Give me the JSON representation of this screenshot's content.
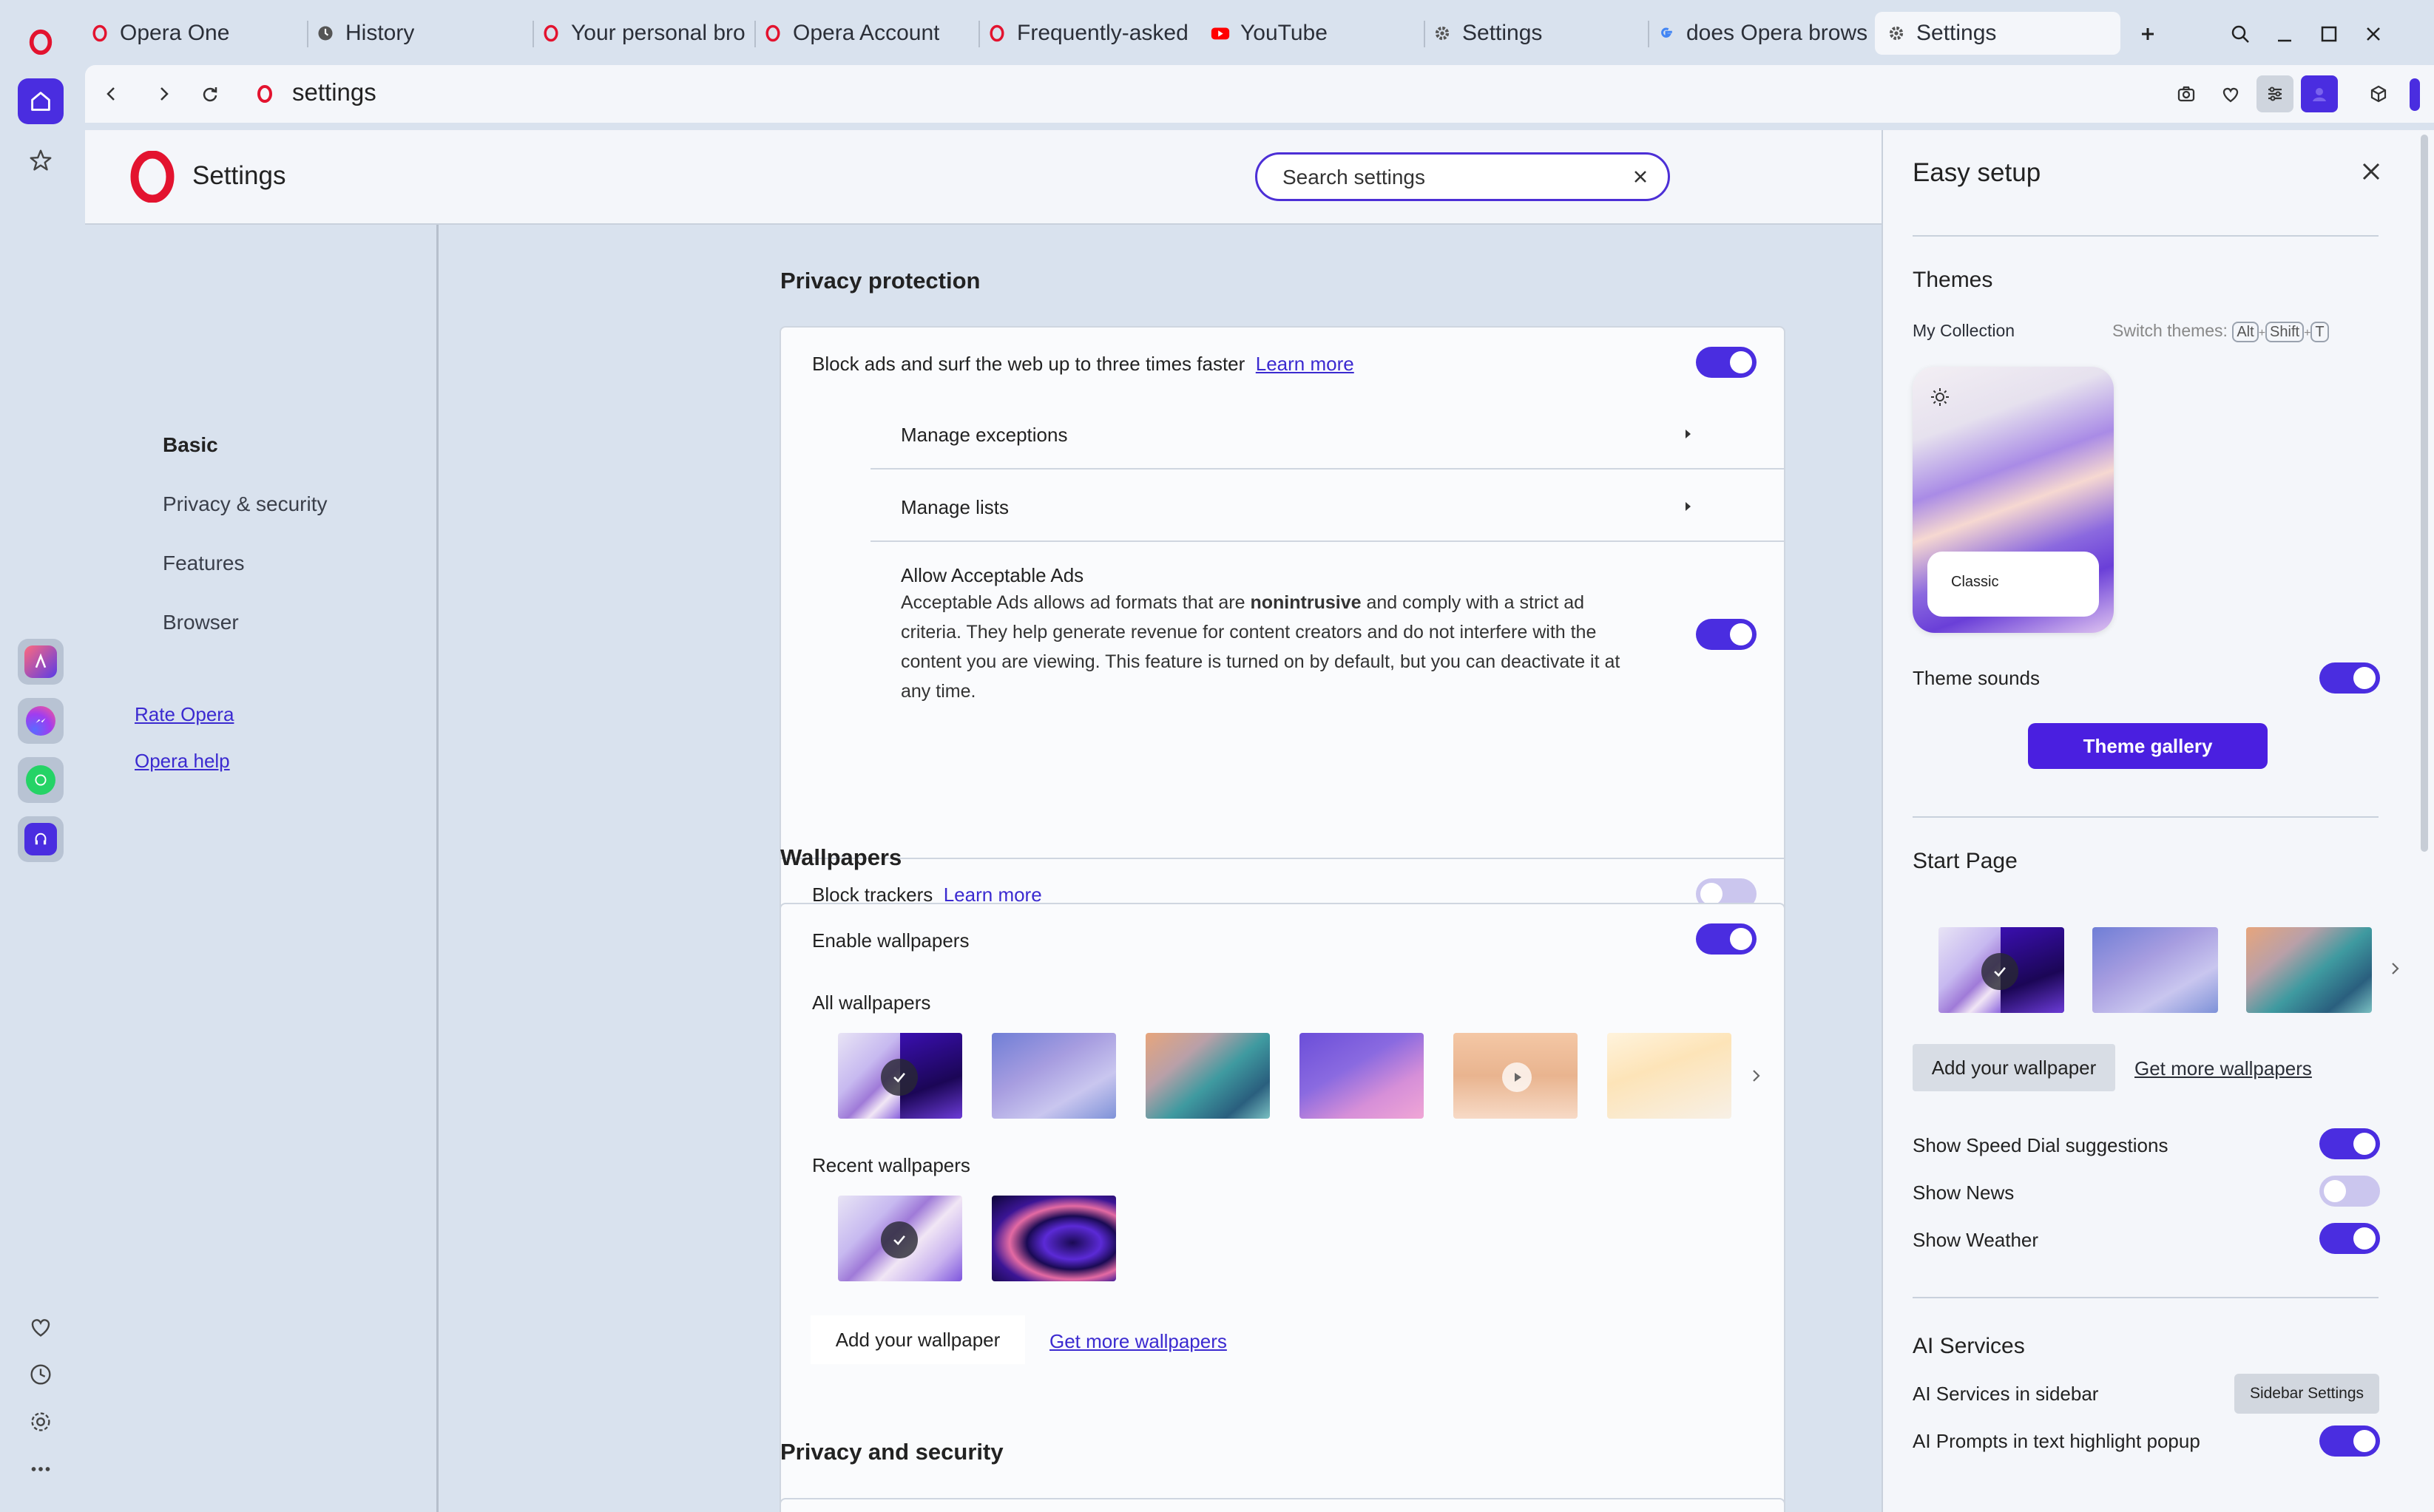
{
  "browser": {
    "tabs": [
      {
        "label": "Opera One",
        "icon": "opera-icon"
      },
      {
        "label": "History",
        "icon": "clock-icon"
      },
      {
        "label": "Your personal bro",
        "icon": "opera-icon"
      },
      {
        "label": "Opera Account",
        "icon": "opera-icon"
      },
      {
        "label": "Frequently-asked",
        "icon": "opera-icon"
      },
      {
        "label": "YouTube",
        "icon": "youtube-icon"
      },
      {
        "label": "Settings",
        "icon": "gear-icon"
      },
      {
        "label": "does Opera brows",
        "icon": "google-icon"
      },
      {
        "label": "Settings",
        "icon": "gear-icon",
        "active": true
      }
    ],
    "address": "settings",
    "accent": "#4a2de0"
  },
  "settings": {
    "title": "Settings",
    "search_placeholder": "Search settings",
    "nav": {
      "items": [
        "Basic",
        "Privacy & security",
        "Features",
        "Browser"
      ],
      "links": [
        "Rate Opera",
        "Opera help"
      ]
    },
    "privacy_protection": {
      "title": "Privacy protection",
      "block_ads": "Block ads and surf the web up to three times faster",
      "learn_more": "Learn more",
      "manage_exceptions": "Manage exceptions",
      "manage_lists": "Manage lists",
      "acceptable_ads_title": "Allow Acceptable Ads",
      "acceptable_ads_pre": "Acceptable Ads allows ad formats that are ",
      "acceptable_ads_bold": "nonintrusive",
      "acceptable_ads_post": " and comply with a strict ad criteria. They help generate revenue for content creators and do not interfere with the content you are viewing. This feature is turned on by default, but you can deactivate it at any time.",
      "block_trackers": "Block trackers",
      "block_ads_on": true,
      "acceptable_ads_on": true,
      "block_trackers_on": false
    },
    "wallpapers": {
      "title": "Wallpapers",
      "enable": "Enable wallpapers",
      "enable_on": true,
      "all_label": "All wallpapers",
      "recent_label": "Recent wallpapers",
      "add": "Add your wallpaper",
      "get_more": "Get more wallpapers"
    },
    "privacy_security_title": "Privacy and security"
  },
  "easy_setup": {
    "title": "Easy setup",
    "themes_title": "Themes",
    "my_collection": "My Collection",
    "switch_themes": "Switch themes:",
    "keys": [
      "Alt",
      "Shift",
      "T"
    ],
    "key_plus": "+",
    "theme_name": "Classic",
    "theme_sounds": "Theme sounds",
    "theme_sounds_on": true,
    "theme_gallery": "Theme gallery",
    "start_page_title": "Start Page",
    "add_wallpaper": "Add your wallpaper",
    "get_more_wallpapers": "Get more wallpapers",
    "speed_dial": "Show Speed Dial suggestions",
    "speed_dial_on": true,
    "news": "Show News",
    "news_on": false,
    "weather": "Show Weather",
    "weather_on": true,
    "ai_title": "AI Services",
    "ai_sidebar": "AI Services in sidebar",
    "sidebar_settings": "Sidebar Settings",
    "ai_prompts": "AI Prompts in text highlight popup",
    "ai_prompts_on": true
  }
}
